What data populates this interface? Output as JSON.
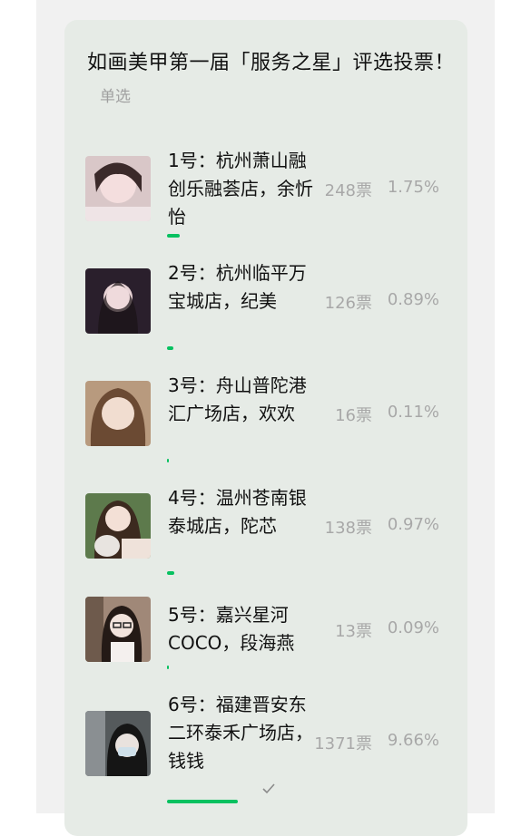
{
  "poll": {
    "title": "如画美甲第一届「服务之星」评选投票！",
    "type_label": "单选"
  },
  "options": [
    {
      "label": "1号：杭州萧山融创乐融荟店，余忻怡",
      "votes": "248票",
      "percent": "1.75%",
      "share": 0.0175,
      "selected": false,
      "avatar_icon": "avatar-photo"
    },
    {
      "label": "2号：杭州临平万宝城店，纪美",
      "votes": "126票",
      "percent": "0.89%",
      "share": 0.0089,
      "selected": false,
      "avatar_icon": "avatar-photo"
    },
    {
      "label": "3号：舟山普陀港汇广场店，欢欢",
      "votes": "16票",
      "percent": "0.11%",
      "share": 0.0011,
      "selected": false,
      "avatar_icon": "avatar-photo"
    },
    {
      "label": "4号：温州苍南银泰城店，陀芯",
      "votes": "138票",
      "percent": "0.97%",
      "share": 0.0097,
      "selected": false,
      "avatar_icon": "avatar-photo"
    },
    {
      "label": "5号：嘉兴星河COCO，段海燕",
      "votes": "13票",
      "percent": "0.09%",
      "share": 0.0009,
      "selected": false,
      "avatar_icon": "avatar-photo"
    },
    {
      "label": "6号：福建晋安东二环泰禾广场店，钱钱",
      "votes": "1371票",
      "percent": "9.66%",
      "share": 0.0966,
      "selected": true,
      "avatar_icon": "avatar-photo"
    }
  ],
  "colors": {
    "accent": "#07c160",
    "muted": "#a8a8a8",
    "card": "#e6ebe6"
  }
}
